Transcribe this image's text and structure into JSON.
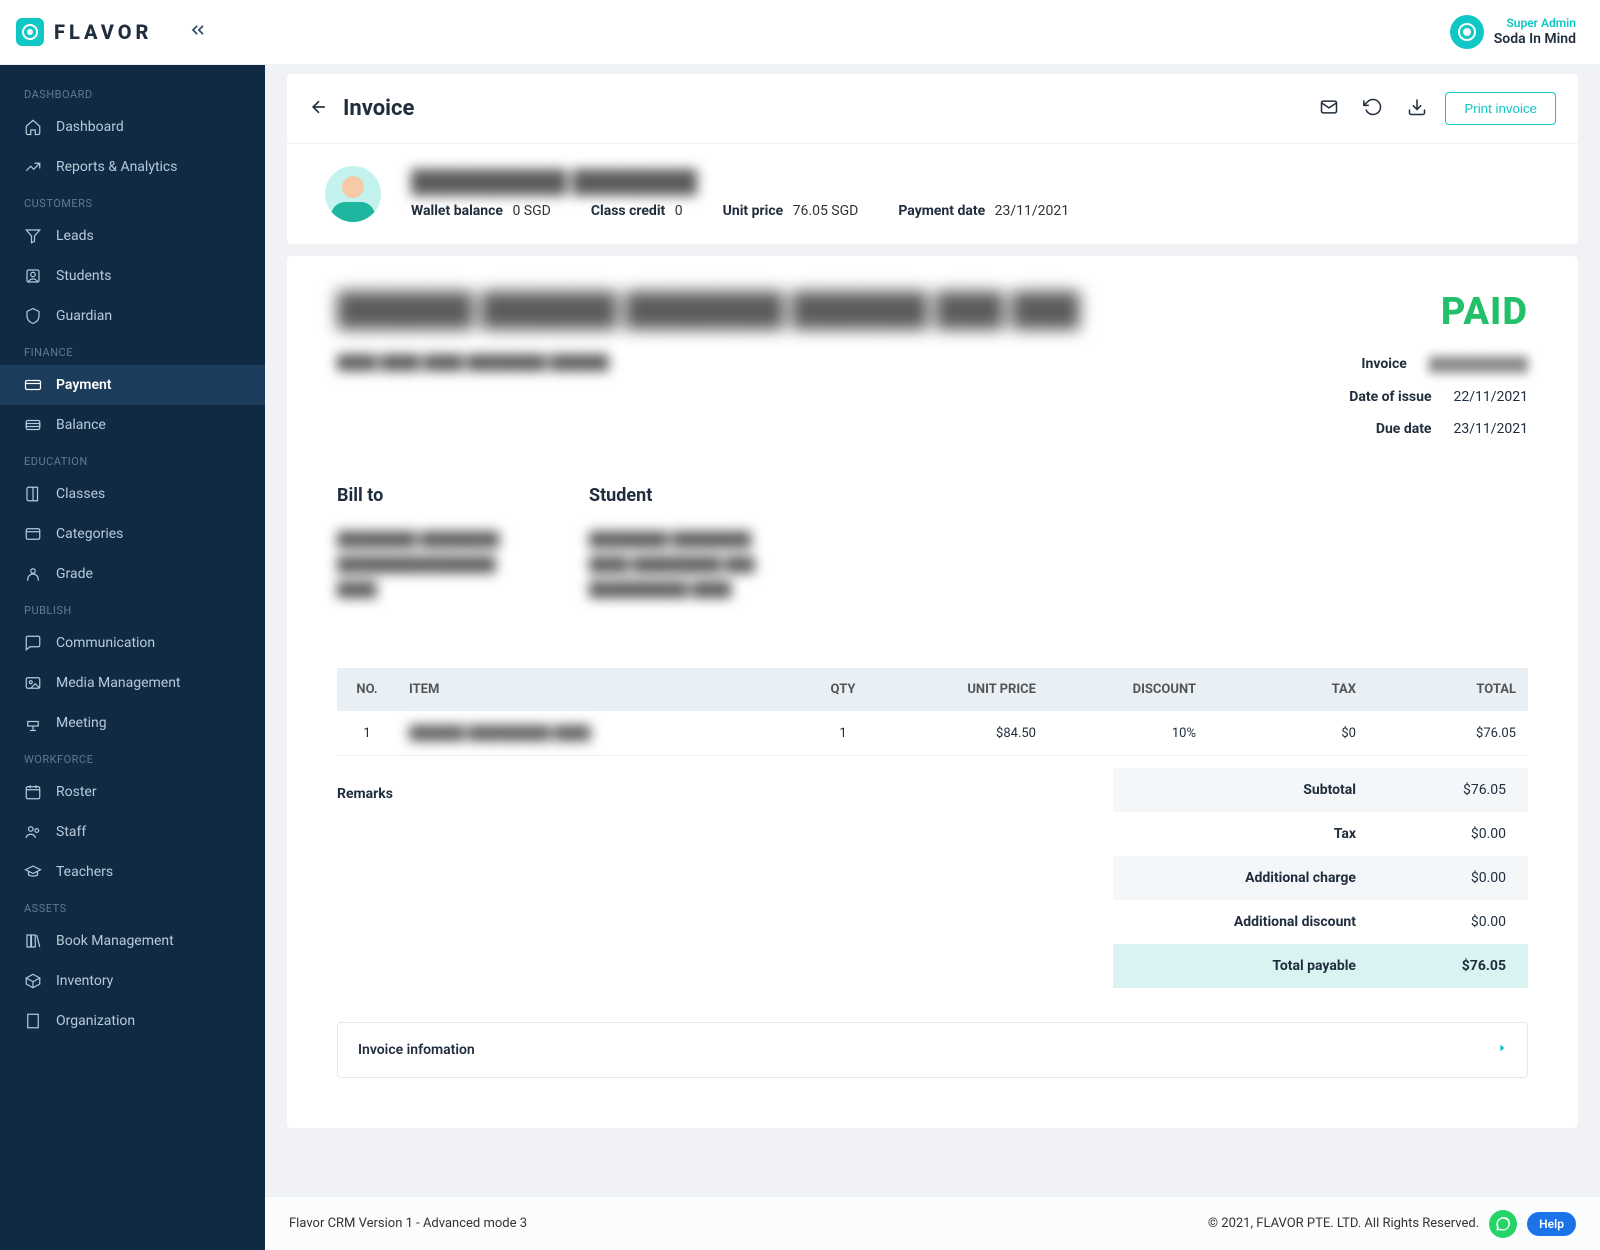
{
  "brand": {
    "name": "FLAVOR"
  },
  "topbar": {
    "role": "Super Admin",
    "org": "Soda In Mind"
  },
  "sidebar": {
    "groups": [
      {
        "label": "DASHBOARD",
        "items": [
          {
            "id": "dashboard",
            "label": "Dashboard",
            "icon": "home-icon"
          },
          {
            "id": "reports",
            "label": "Reports & Analytics",
            "icon": "chart-icon"
          }
        ]
      },
      {
        "label": "CUSTOMERS",
        "items": [
          {
            "id": "leads",
            "label": "Leads",
            "icon": "funnel-icon"
          },
          {
            "id": "students",
            "label": "Students",
            "icon": "user-icon"
          },
          {
            "id": "guardian",
            "label": "Guardian",
            "icon": "shield-icon"
          }
        ]
      },
      {
        "label": "FINANCE",
        "items": [
          {
            "id": "payment",
            "label": "Payment",
            "icon": "card-icon",
            "active": true
          },
          {
            "id": "balance",
            "label": "Balance",
            "icon": "wallet-icon"
          }
        ]
      },
      {
        "label": "EDUCATION",
        "items": [
          {
            "id": "classes",
            "label": "Classes",
            "icon": "book-icon"
          },
          {
            "id": "categories",
            "label": "Categories",
            "icon": "tag-icon"
          },
          {
            "id": "grade",
            "label": "Grade",
            "icon": "grade-icon"
          }
        ]
      },
      {
        "label": "PUBLISH",
        "items": [
          {
            "id": "communication",
            "label": "Communication",
            "icon": "chat-icon"
          },
          {
            "id": "media",
            "label": "Media Management",
            "icon": "media-icon"
          },
          {
            "id": "meeting",
            "label": "Meeting",
            "icon": "podium-icon"
          }
        ]
      },
      {
        "label": "WORKFORCE",
        "items": [
          {
            "id": "roster",
            "label": "Roster",
            "icon": "calendar-icon"
          },
          {
            "id": "staff",
            "label": "Staff",
            "icon": "people-icon"
          },
          {
            "id": "teachers",
            "label": "Teachers",
            "icon": "mortar-icon"
          }
        ]
      },
      {
        "label": "ASSETS",
        "items": [
          {
            "id": "bookmgmt",
            "label": "Book Management",
            "icon": "library-icon"
          },
          {
            "id": "inventory",
            "label": "Inventory",
            "icon": "box-icon"
          },
          {
            "id": "organization",
            "label": "Organization",
            "icon": "building-icon"
          }
        ]
      }
    ]
  },
  "page": {
    "title": "Invoice",
    "print_label": "Print invoice"
  },
  "summary": {
    "name_placeholder": "██████████ ████████",
    "wallet_balance_label": "Wallet balance",
    "wallet_balance": "0 SGD",
    "class_credit_label": "Class credit",
    "class_credit": "0",
    "unit_price_label": "Unit price",
    "unit_price": "76.05 SGD",
    "payment_date_label": "Payment date",
    "payment_date": "23/11/2021"
  },
  "invoice": {
    "company_name_placeholder": "██████ ██████ ███████ ██████ ███ ███",
    "company_addr_placeholder": "████ ████ ████ ████████\n██████",
    "status": "PAID",
    "meta": {
      "invoice_label": "Invoice",
      "invoice_no_placeholder": "██████████",
      "issue_label": "Date of issue",
      "issue": "22/11/2021",
      "due_label": "Due date",
      "due": "23/11/2021"
    },
    "bill_to_label": "Bill to",
    "student_label": "Student",
    "bill_to_body_placeholder": "████████ ████████\n████████████████\n████",
    "student_body_placeholder": "████████ ████████\n████\n█████████ ███\n██████████ ████",
    "table": {
      "headers": {
        "no": "NO.",
        "item": "ITEM",
        "qty": "QTY",
        "unit_price": "UNIT PRICE",
        "discount": "DISCOUNT",
        "tax": "TAX",
        "total": "TOTAL"
      },
      "rows": [
        {
          "no": "1",
          "item_placeholder": "██████ █████████ ████",
          "qty": "1",
          "unit_price": "$84.50",
          "discount": "10%",
          "tax": "$0",
          "total": "$76.05"
        }
      ]
    },
    "remarks_label": "Remarks",
    "totals": {
      "subtotal_label": "Subtotal",
      "subtotal": "$76.05",
      "tax_label": "Tax",
      "tax": "$0.00",
      "addcharge_label": "Additional charge",
      "addcharge": "$0.00",
      "adddisc_label": "Additional discount",
      "adddisc": "$0.00",
      "payable_label": "Total payable",
      "payable": "$76.05"
    },
    "accordion_label": "Invoice infomation"
  },
  "footer": {
    "left": "Flavor CRM Version 1 - Advanced mode 3",
    "right": "© 2021, FLAVOR PTE. LTD. All Rights Reserved.",
    "help": "Help"
  }
}
